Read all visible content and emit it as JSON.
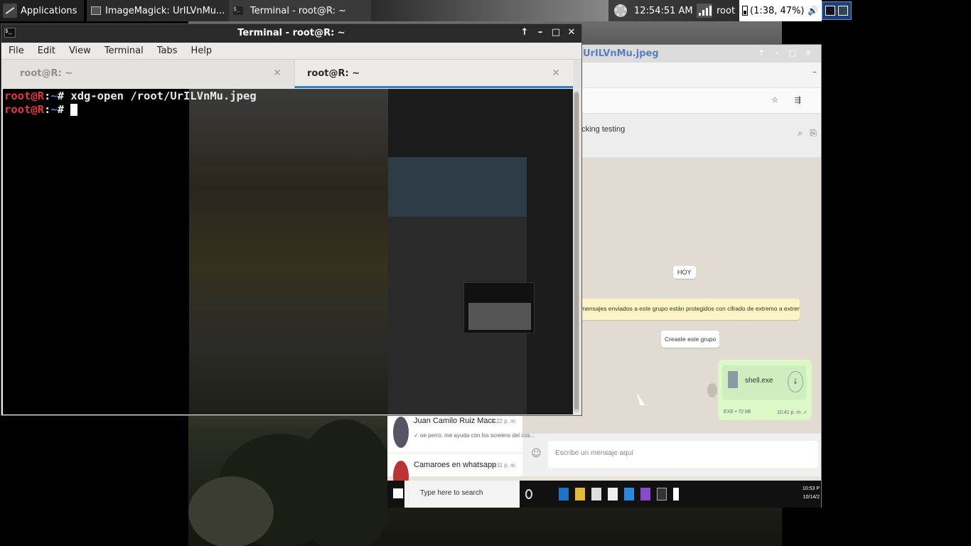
{
  "panel": {
    "applications_label": "Applications",
    "tasks": [
      {
        "label": "ImageMagick: UrILVnMu..."
      },
      {
        "label": "Terminal - root@R: ~"
      }
    ],
    "clock": "12:54:51 AM",
    "user": "root",
    "battery": "(1:38, 47%)"
  },
  "viewer": {
    "title": "UrILVnMu.jpeg"
  },
  "whatsapp": {
    "chat_name": "ethical hacking testing",
    "day_badge": "HOY",
    "encryption_notice": "Los mensajes enviados a este grupo están protegidos con cifrado de extremo a extremo. Haz clic para ver más información.",
    "group_created": "Creaste este grupo",
    "file_name": "shell.exe",
    "file_meta": "EXE • 72 kB",
    "file_time": "10:41 p. m. ✓",
    "composer_placeholder": "Escribe un mensaje aquí",
    "sidebar": [
      {
        "name": "Juan Camilo Ruiz Macc",
        "time": "8:22 p. m.",
        "snippet": "✓ oe perro, me ayuda con los screens del cos..."
      },
      {
        "name": "Camaroes en whatsapp",
        "time": "7:11 p. m.",
        "snippet": ""
      }
    ],
    "windows_search": "Type here to search",
    "windows_clock": "10:53 P\n10/14/2"
  },
  "terminal": {
    "title": "Terminal - root@R: ~",
    "menu": [
      "File",
      "Edit",
      "View",
      "Terminal",
      "Tabs",
      "Help"
    ],
    "tabs": [
      {
        "label": "root@R: ~",
        "active": false
      },
      {
        "label": "root@R: ~",
        "active": true
      }
    ],
    "lines": [
      {
        "user": "root@R",
        "sep": ":",
        "dir": "~",
        "symbol": "# ",
        "command": "xdg-open /root/UrILVnMu.jpeg"
      },
      {
        "user": "root@R",
        "sep": ":",
        "dir": "~",
        "symbol": "# ",
        "command": ""
      }
    ]
  }
}
